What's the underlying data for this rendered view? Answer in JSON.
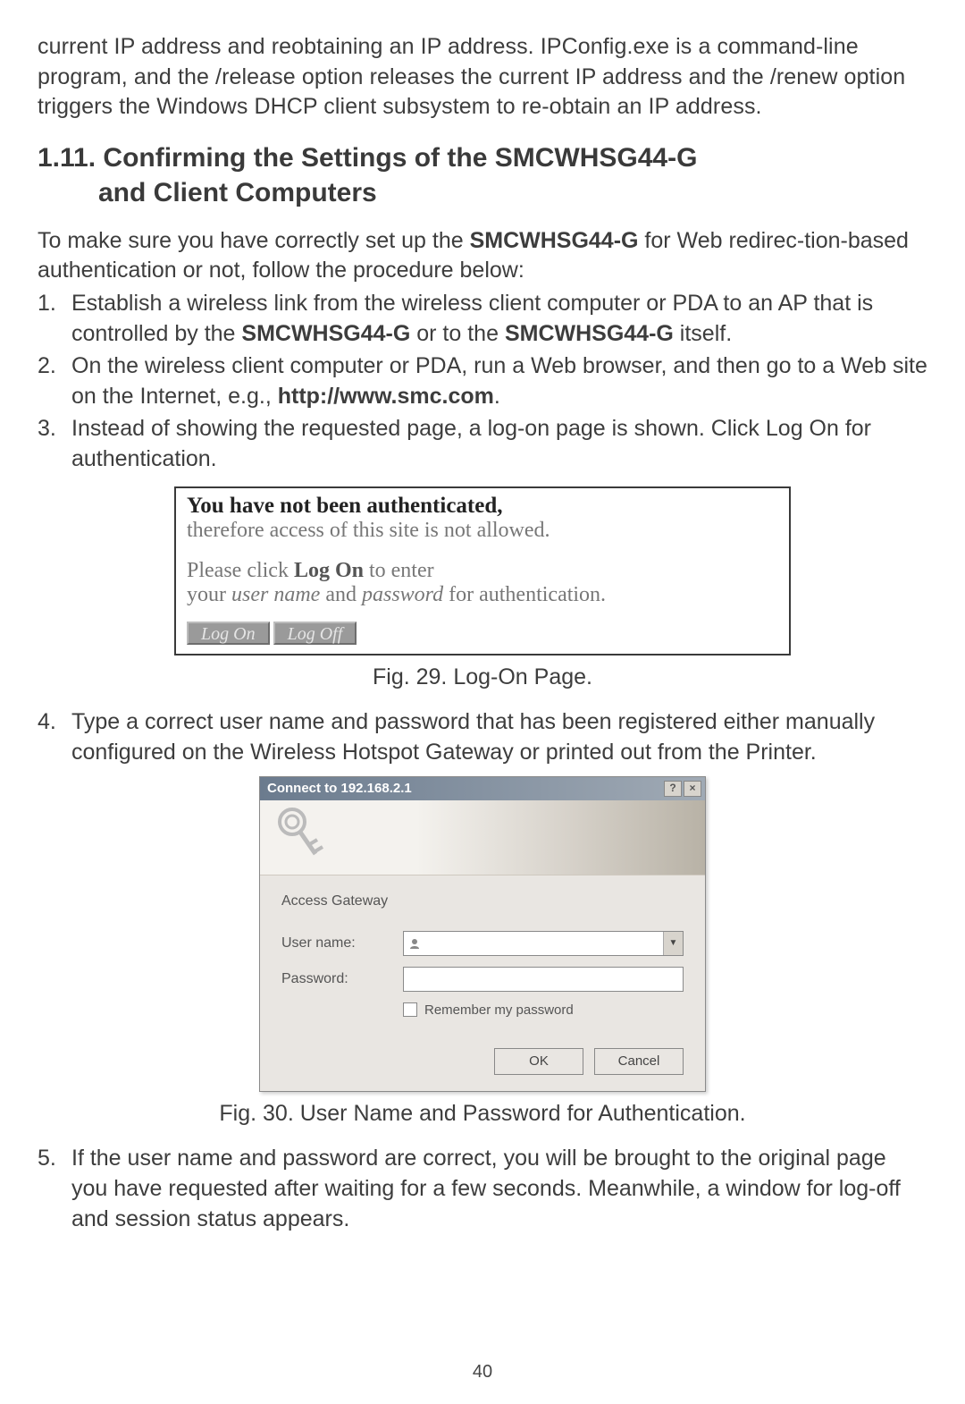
{
  "intro_para": "current IP address and reobtaining an IP address. IPConfig.exe is a command-line program, and the /release option releases the current IP address and the /renew option triggers the Windows DHCP client subsystem to re-obtain an IP address.",
  "section": {
    "num_title": "1.11. Confirming the Settings of the SMCWHSG44-G",
    "title_line2": "and Client Computers"
  },
  "lead": {
    "t1": "To make sure you have correctly set up the ",
    "b1": "SMCWHSG44-G",
    "t2": " for Web redirec-tion-based authentication or not, follow the procedure below:"
  },
  "steps": {
    "s1": {
      "t1": "Establish a wireless link from the wireless client computer or PDA to an AP that is controlled by the ",
      "b1": "SMCWHSG44-G",
      "t2": " or to the ",
      "b2": "SMCWHSG44-G",
      "t3": " itself."
    },
    "s2": {
      "t1": "On the wireless client computer or PDA, run a Web browser, and then go to a Web site on the Internet, e.g., ",
      "b1": "http://www.smc.com",
      "t2": "."
    },
    "s3": {
      "t1": "Instead of showing the requested page, a log-on page is shown. Click Log On for authentication."
    },
    "s4": {
      "t1": "Type a correct user name and password that has been registered either manually configured on the Wireless Hotspot Gateway or printed out from the Printer."
    },
    "s5": {
      "t1": "If the user name and password are correct, you will be brought to the original page you have requested after waiting for a few seconds. Meanwhile, a window for log-off and session status appears."
    }
  },
  "fig29": {
    "l1a": "You have not been authenticated,",
    "l2": "therefore access of this site is not allowed.",
    "l3a": "Please click ",
    "l3b": "Log On",
    "l3c": " to enter",
    "l4a": "your ",
    "l4b": "user name",
    "l4c": " and ",
    "l4d": "password",
    "l4e": " for authentication.",
    "btn1": "Log On",
    "btn2": "Log Off",
    "caption": "Fig. 29. Log-On Page."
  },
  "fig30": {
    "title": "Connect to 192.168.2.1",
    "help": "?",
    "close": "×",
    "realm": "Access Gateway",
    "user_label": "User name:",
    "pass_label": "Password:",
    "remember": "Remember my password",
    "ok": "OK",
    "cancel": "Cancel",
    "caption": "Fig. 30. User Name and Password for Authentication."
  },
  "page_number": "40"
}
